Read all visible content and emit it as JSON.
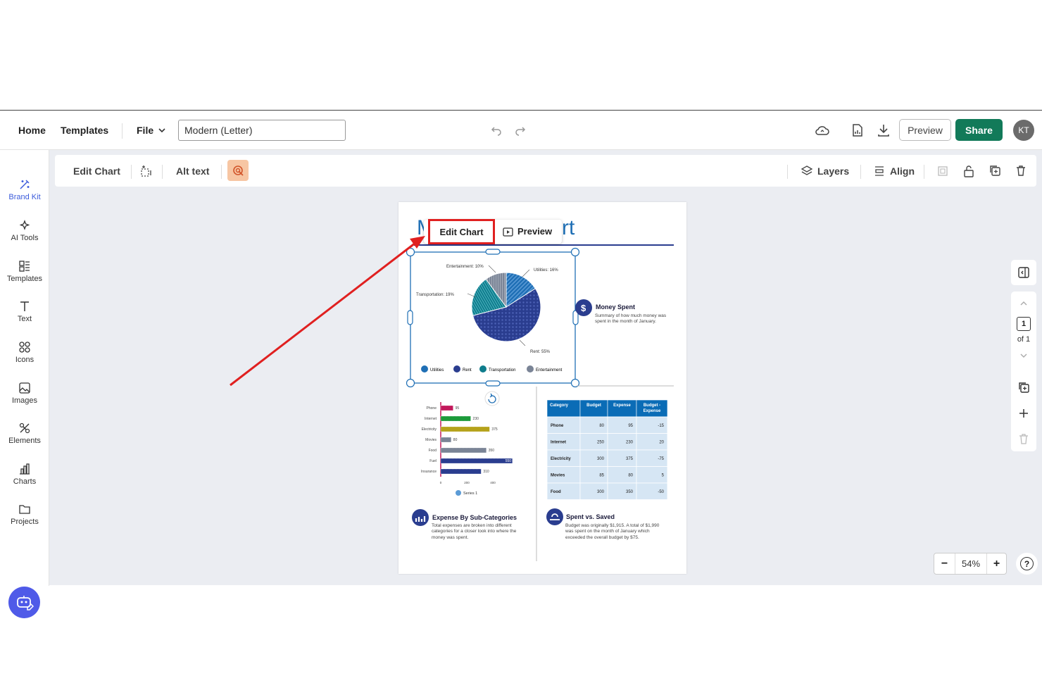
{
  "topbar": {
    "home": "Home",
    "templates": "Templates",
    "file": "File",
    "doc_title": "Modern (Letter)",
    "preview": "Preview",
    "share": "Share",
    "avatar": "KT"
  },
  "sidebar": [
    {
      "label": "Brand Kit",
      "icon": "brand-kit-icon"
    },
    {
      "label": "AI Tools",
      "icon": "ai-tools-icon"
    },
    {
      "label": "Templates",
      "icon": "templates-icon"
    },
    {
      "label": "Text",
      "icon": "text-icon"
    },
    {
      "label": "Icons",
      "icon": "icons-icon"
    },
    {
      "label": "Images",
      "icon": "images-icon"
    },
    {
      "label": "Elements",
      "icon": "elements-icon"
    },
    {
      "label": "Charts",
      "icon": "charts-icon"
    },
    {
      "label": "Projects",
      "icon": "projects-icon"
    }
  ],
  "toolbar": {
    "edit_chart": "Edit Chart",
    "alt_text": "Alt text",
    "layers": "Layers",
    "align": "Align"
  },
  "float_menu": {
    "edit_chart": "Edit Chart",
    "preview": "Preview"
  },
  "pager": {
    "current": "1",
    "of": "of 1"
  },
  "zoom": {
    "minus": "−",
    "value": "54%",
    "plus": "+",
    "help": "?"
  },
  "document": {
    "title_left": "M",
    "title_right": "rt",
    "money_spent": {
      "title": "Money Spent",
      "body": "Summary of how much money was spent in the month of January."
    },
    "expense_sub": {
      "title": "Expense By Sub-Categories",
      "body": "Total expenses are broken into different categories for a closer look into where the money was spent."
    },
    "spent_saved": {
      "title": "Spent vs. Saved",
      "body": "Budget was originally $1,915. A total of $1,990 was spent on the month of January which exceeded the overall budget by $75."
    },
    "table": {
      "headers": [
        "Category",
        "Budget",
        "Expense",
        "Budget - Expense"
      ],
      "rows": [
        [
          "Phone",
          "80",
          "95",
          "-15"
        ],
        [
          "Internet",
          "250",
          "230",
          "20"
        ],
        [
          "Electricity",
          "300",
          "375",
          "-75"
        ],
        [
          "Movies",
          "85",
          "80",
          "5"
        ],
        [
          "Food",
          "300",
          "350",
          "-50"
        ]
      ]
    }
  },
  "chart_data": [
    {
      "type": "pie",
      "slices": [
        {
          "label": "Utilities",
          "value": 16,
          "color": "#1f6fb5"
        },
        {
          "label": "Rent",
          "value": 55,
          "color": "#2a3d8f"
        },
        {
          "label": "Transportation",
          "value": 19,
          "color": "#0e7c8c"
        },
        {
          "label": "Entertainment",
          "value": 10,
          "color": "#7a8496"
        }
      ],
      "callouts": [
        "Utilities: 16%",
        "Rent: 55%",
        "Transportation: 19%",
        "Entertainment: 10%"
      ],
      "legend": [
        "Utilities",
        "Rent",
        "Transportation",
        "Entertainment"
      ]
    },
    {
      "type": "bar",
      "orientation": "horizontal",
      "categories": [
        "Phone",
        "Internet",
        "Electricity",
        "Movies",
        "Food",
        "Fuel",
        "Insurance"
      ],
      "values": [
        95,
        230,
        375,
        80,
        350,
        550,
        310
      ],
      "colors": [
        "#c2185b",
        "#1c9a3a",
        "#b5a21a",
        "#7a8496",
        "#7a8496",
        "#2a3d8f",
        "#2a3d8f"
      ],
      "xticks": [
        "0",
        "200",
        "400"
      ],
      "xlim": [
        0,
        600
      ],
      "series": [
        {
          "name": "Series 1"
        }
      ]
    }
  ]
}
